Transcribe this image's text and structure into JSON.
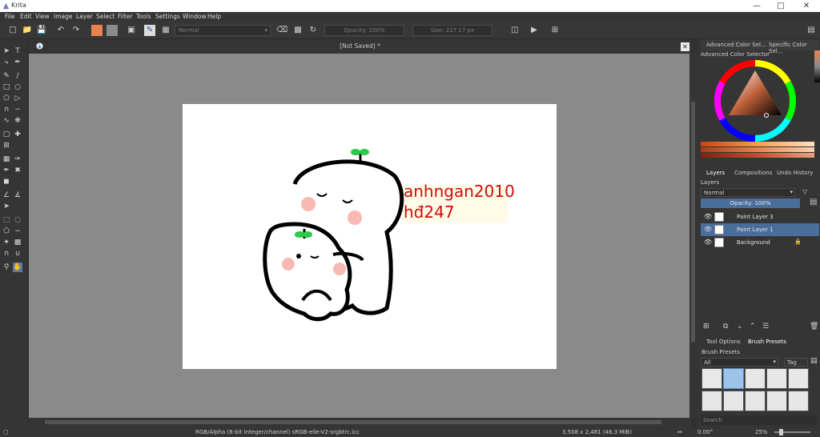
{
  "app": {
    "title": "Krita"
  },
  "menu": [
    "File",
    "Edit",
    "View",
    "Image",
    "Layer",
    "Select",
    "Filter",
    "Tools",
    "Settings",
    "Window",
    "Help"
  ],
  "toolbar": {
    "blend_mode": "Normal",
    "opacity": "Opacity: 100%",
    "size": "Size: 227.17 px",
    "fg_color": "#e8834f",
    "bg_color": "#8a8a8a"
  },
  "document": {
    "tab_title": "[Not Saved]  *",
    "canvas_text_line1": "anhngan2010",
    "canvas_text_line2": "hđ247",
    "text_color": "#d00c0c"
  },
  "right_panel": {
    "top_tabs": [
      "Advanced Color Sel...",
      "Specific Color Sel..."
    ],
    "color_selector_title": "Advanced Color Selector",
    "layer_tabs": [
      "Layers",
      "Compositions",
      "Undo History"
    ],
    "layers_title": "Layers",
    "blend_mode": "Normal",
    "opacity": "Opacity:  100%",
    "layers": [
      {
        "name": "Paint Layer 3",
        "selected": false
      },
      {
        "name": "Paint Layer 1",
        "selected": true
      },
      {
        "name": "Background",
        "selected": false
      }
    ],
    "bottom_tabs": [
      "Tool Options",
      "Brush Presets"
    ],
    "brush_presets_title": "Brush Presets",
    "preset_filter": "All",
    "tag_label": "Tag",
    "search_placeholder": "Search"
  },
  "status": {
    "color_space": "RGB/Alpha (8-bit integer/channel)  sRGB-elle-V2-srgbtrc.icc",
    "dimensions": "3,508 x 2,481 (46.3 MiB)",
    "rotation": "0.00°",
    "zoom": "25%"
  }
}
